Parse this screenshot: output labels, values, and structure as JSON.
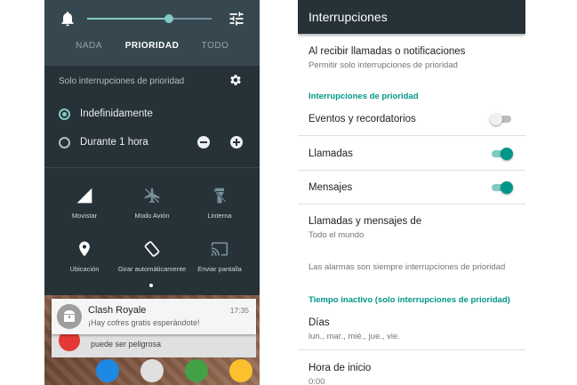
{
  "left": {
    "volume": {
      "level": 0.66
    },
    "tabs": [
      {
        "label": "NADA",
        "active": false
      },
      {
        "label": "PRIORIDAD",
        "active": true
      },
      {
        "label": "TODO",
        "active": false
      }
    ],
    "priority_header": "Solo interrupciones de prioridad",
    "options": [
      {
        "label": "Indefinidamente",
        "checked": true
      },
      {
        "label": "Durante 1 hora",
        "checked": false
      }
    ],
    "tiles": [
      {
        "label": "Movistar",
        "icon": "signal-icon"
      },
      {
        "label": "Modo Avión",
        "icon": "airplane-off-icon"
      },
      {
        "label": "Linterna",
        "icon": "flashlight-off-icon"
      },
      {
        "label": "Ubicación",
        "icon": "location-icon"
      },
      {
        "label": "Girar automáticamente",
        "icon": "screen-rotation-icon"
      },
      {
        "label": "Enviar pantalla",
        "icon": "cast-icon"
      }
    ],
    "notification": {
      "title": "Clash Royale",
      "body": "¡Hay cofres gratis esperándote!",
      "time": "17:35"
    },
    "notification_under": {
      "body": "puede ser peligrosa"
    }
  },
  "right": {
    "title": "Interrupciones",
    "row_notify": {
      "title": "Al recibir llamadas o notificaciones",
      "subtitle": "Permitir solo interrupciones de prioridad"
    },
    "section_priority": "Interrupciones de prioridad",
    "toggles": [
      {
        "label": "Eventos y recordatorios",
        "on": false
      },
      {
        "label": "Llamadas",
        "on": true
      },
      {
        "label": "Mensajes",
        "on": true
      }
    ],
    "row_calls_from": {
      "title": "Llamadas y mensajes de",
      "subtitle": "Todo el mundo"
    },
    "alarms_info": "Las alarmas son siempre interrupciones de prioridad",
    "section_downtime": "Tiempo inactivo (solo interrupciones de prioridad)",
    "row_days": {
      "title": "Días",
      "subtitle": "lun., mar., mié., jue., vie."
    },
    "row_start": {
      "title": "Hora de inicio",
      "subtitle": "0:00"
    }
  }
}
